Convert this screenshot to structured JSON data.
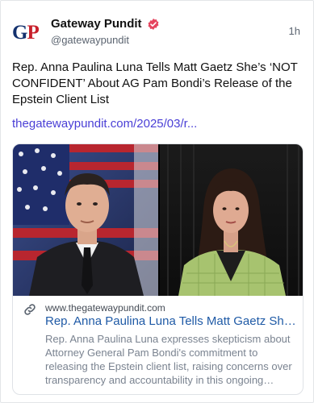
{
  "account": {
    "display_name": "Gateway Pundit",
    "handle": "@gatewaypundit",
    "avatar_text_g": "G",
    "avatar_text_p": "P",
    "verified": true,
    "timestamp": "1h"
  },
  "post": {
    "text": "Rep. Anna Paulina Luna Tells Matt Gaetz She’s ‘NOT CONFIDENT’ About AG Pam Bondi’s Release of the Epstein Client List",
    "link_text": "thegatewaypundit.com/2025/03/r..."
  },
  "card": {
    "domain": "www.thegatewaypundit.com",
    "title": "Rep. Anna Paulina Luna Tells Matt Gaetz She’s ‘NOT CONFIDENT’ About AG Pam Bondi’s Release of the Epstein Client List",
    "description": "Rep. Anna Paulina Luna expresses skepticism about Attorney General Pam Bondi's commitment to releasing the Epstein client list, raising concerns over transparency and accountability in this ongoing political saga."
  },
  "icons": {
    "verified": "verified-badge-icon",
    "link": "link-icon"
  },
  "colors": {
    "link": "#4a3fd6",
    "verified": "#e5445e",
    "card_title": "#1f5aa6"
  }
}
